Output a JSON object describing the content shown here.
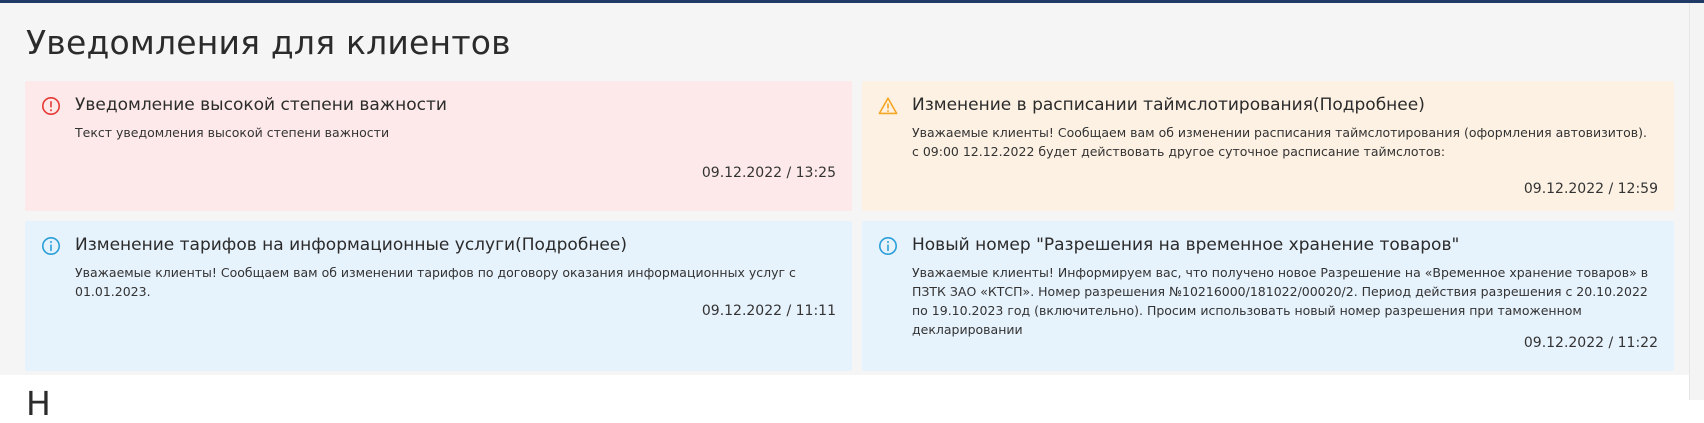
{
  "page": {
    "title": "Уведомления для клиентов",
    "next_section_title": "Н"
  },
  "colors": {
    "top_bar": "#1f3a66",
    "danger_bg": "#fde9e9",
    "danger_icon": "#e53935",
    "warning_bg": "#fdf1e3",
    "warning_icon": "#f5a623",
    "info_bg": "#e6f2fc",
    "info_icon": "#2a9fd8"
  },
  "notifications": [
    {
      "severity": "danger",
      "icon": "alert-circle-icon",
      "title": "Уведомление высокой степени важности",
      "text": "Текст уведомления высокой степени важности",
      "datetime": "09.12.2022 / 13:25"
    },
    {
      "severity": "warning",
      "icon": "warning-triangle-icon",
      "title": "Изменение в расписании таймслотирования(Подробнее)",
      "text": "Уважаемые клиенты! Сообщаем вам об изменении расписания таймслотирования (оформления автовизитов). с 09:00 12.12.2022 будет действовать другое суточное расписание таймслотов:",
      "datetime": "09.12.2022 / 12:59"
    },
    {
      "severity": "info",
      "icon": "info-circle-icon",
      "title": "Изменение тарифов на информационные услуги(Подробнее)",
      "text": "Уважаемые клиенты! Сообщаем вам об изменении тарифов по договору оказания информационных услуг с 01.01.2023.",
      "datetime": "09.12.2022 / 11:11"
    },
    {
      "severity": "info",
      "icon": "info-circle-icon",
      "title": "Новый номер \"Разрешения на временное хранение товаров\"",
      "text": "Уважаемые клиенты! Информируем вас, что получено новое Разрешение на «Временное хранение товаров» в ПЗТК ЗАО «КТСП». Номер разрешения №10216000/181022/00020/2. Период действия разрешения с 20.10.2022 по 19.10.2023 год (включительно). Просим использовать новый номер разрешения при таможенном декларировании",
      "datetime": "09.12.2022 / 11:22"
    }
  ]
}
